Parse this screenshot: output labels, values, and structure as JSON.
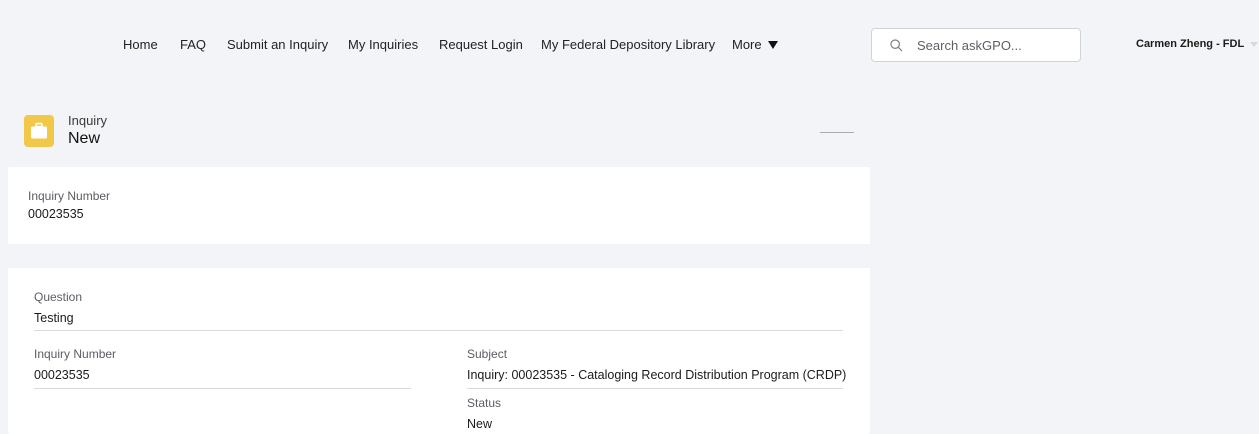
{
  "nav": {
    "items": [
      {
        "label": "Home"
      },
      {
        "label": "FAQ"
      },
      {
        "label": "Submit an Inquiry"
      },
      {
        "label": "My Inquiries"
      },
      {
        "label": "Request Login"
      },
      {
        "label": "My Federal Depository Library"
      }
    ],
    "more_label": "More"
  },
  "search": {
    "placeholder": "Search askGPO..."
  },
  "user": {
    "name": "Carmen Zheng - FDL"
  },
  "record": {
    "type": "Inquiry",
    "title": "New"
  },
  "highlights": {
    "inquiry_number_label": "Inquiry Number",
    "inquiry_number_value": "00023535"
  },
  "details": {
    "question_label": "Question",
    "question_value": "Testing",
    "inquiry_number_label": "Inquiry Number",
    "inquiry_number_value": "00023535",
    "subject_label": "Subject",
    "subject_value": "Inquiry: 00023535 - Cataloging Record Distribution Program (CRDP)",
    "status_label": "Status",
    "status_value": "New"
  },
  "colors": {
    "page_bg": "#f3f4f7",
    "card_bg": "#ffffff",
    "record_icon": "#f1c84a"
  },
  "icons": {
    "search": "search-icon",
    "record": "briefcase-icon",
    "more": "triangle-down-icon"
  }
}
